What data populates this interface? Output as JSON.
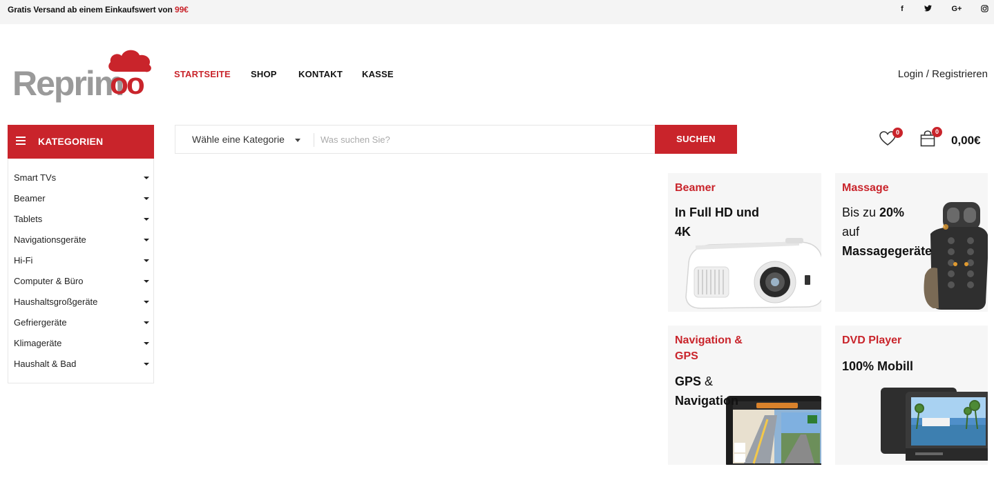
{
  "topbar": {
    "promo_text": "Gratis Versand ab einem Einkaufswert von ",
    "promo_amount": "99€",
    "social": [
      {
        "icon": "facebook-icon",
        "glyph": "f"
      },
      {
        "icon": "twitter-icon",
        "glyph": "t"
      },
      {
        "icon": "google-plus-icon",
        "glyph": "G+"
      },
      {
        "icon": "instagram-icon",
        "glyph": "◎"
      }
    ]
  },
  "brand": {
    "logo_text_grey": "Reprim",
    "logo_text_red": "oo",
    "color_primary": "#c9242b",
    "color_logo_grey": "#9a9a9a"
  },
  "nav": {
    "items": [
      "STARTSEITE",
      "SHOP",
      "KONTAKT",
      "KASSE"
    ],
    "active_index": 0
  },
  "account": {
    "login": "Login",
    "separator": " / ",
    "register": "Registrieren"
  },
  "categories": {
    "title": "KATEGORIEN",
    "items": [
      "Smart TVs",
      "Beamer",
      "Tablets",
      "Navigationsgeräte",
      "Hi-Fi",
      "Computer & Büro",
      "Haushaltsgroßgeräte",
      "Gefriergeräte",
      "Klimageräte",
      "Haushalt & Bad"
    ]
  },
  "search": {
    "category_select": "Wähle eine Kategorie",
    "placeholder": "Was suchen Sie?",
    "button": "SUCHEN"
  },
  "wishlist": {
    "count": "0",
    "icon": "heart-icon"
  },
  "cart": {
    "count": "0",
    "total": "0,00€",
    "icon": "shopping-bag-icon"
  },
  "promos": {
    "beamer": {
      "title": "Beamer",
      "line1": "In Full HD und",
      "line2": "4K"
    },
    "massage": {
      "title": "Massage",
      "line1_pre": "Bis zu ",
      "line1_bold": "20%",
      "line2": "auf",
      "line3": "Massagegeräte"
    },
    "navigation": {
      "title_line1": "Navigation &",
      "title_line2": "GPS",
      "line1_bold": "GPS",
      "line1_rest": " &",
      "line2": "Navigation"
    },
    "dvd": {
      "title": "DVD Player",
      "line1": "100% Mobill"
    }
  }
}
